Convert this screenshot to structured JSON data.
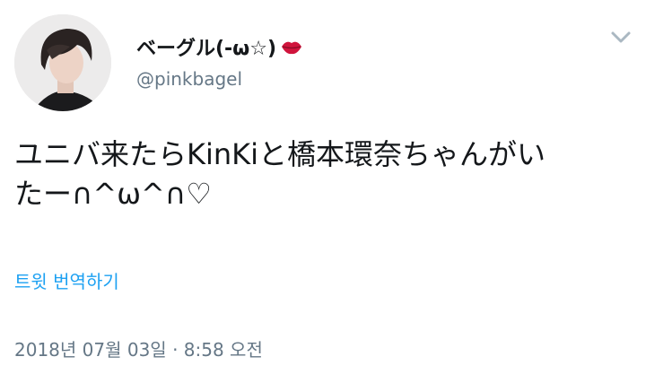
{
  "tweet": {
    "author": {
      "display_name": "ベーグル(-ω☆)",
      "handle": "@pinkbagel",
      "avatar": "profile-photo",
      "name_emoji": "lips-icon"
    },
    "text_line1": "ユニバ来たらKinKiと橋本環奈ちゃんがい",
    "text_line2": "たー∩^ω^∩♡",
    "translate_label": "트윗 번역하기",
    "timestamp": "2018년 07월 03일 · 8:58 오전",
    "menu_icon": "chevron-down-icon"
  },
  "colors": {
    "text_primary": "#14171a",
    "text_secondary": "#657786",
    "link": "#1da1f2",
    "chevron": "#aab8c2",
    "emoji": "#d0143c"
  }
}
